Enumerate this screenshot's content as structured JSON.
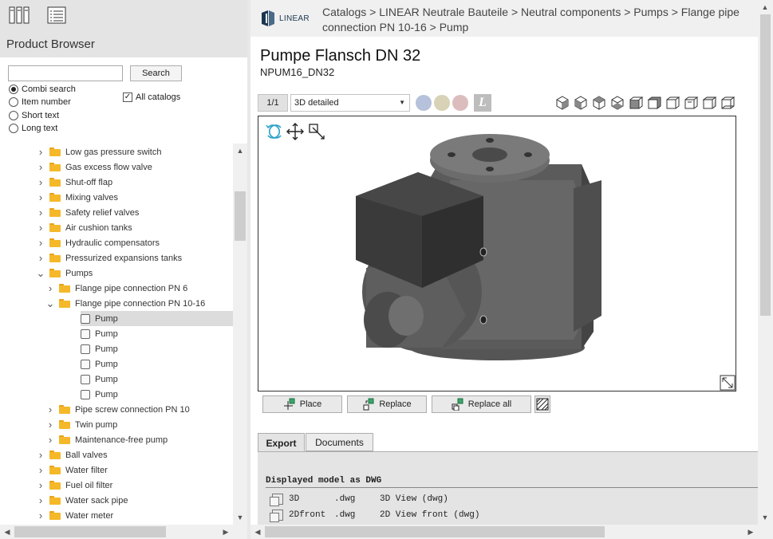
{
  "left_panel": {
    "title": "Product Browser",
    "search": {
      "value": "",
      "placeholder": "",
      "button_label": "Search"
    },
    "search_modes": [
      "Combi search",
      "Item number",
      "Short text",
      "Long text"
    ],
    "selected_mode": "Combi search",
    "all_catalogs_label": "All catalogs",
    "all_catalogs_checked": true,
    "tree": [
      {
        "label": "Low gas pressure switch",
        "type": "folder",
        "level": 0,
        "state": "collapsed"
      },
      {
        "label": "Gas excess flow valve",
        "type": "folder",
        "level": 0,
        "state": "collapsed"
      },
      {
        "label": "Shut-off flap",
        "type": "folder",
        "level": 0,
        "state": "collapsed"
      },
      {
        "label": "Mixing valves",
        "type": "folder",
        "level": 0,
        "state": "collapsed"
      },
      {
        "label": "Safety relief valves",
        "type": "folder",
        "level": 0,
        "state": "collapsed"
      },
      {
        "label": "Air cushion tanks",
        "type": "folder",
        "level": 0,
        "state": "collapsed"
      },
      {
        "label": "Hydraulic compensators",
        "type": "folder",
        "level": 0,
        "state": "collapsed"
      },
      {
        "label": "Pressurized expansions tanks",
        "type": "folder",
        "level": 0,
        "state": "collapsed"
      },
      {
        "label": "Pumps",
        "type": "folder",
        "level": 0,
        "state": "expanded"
      },
      {
        "label": "Flange pipe connection PN 6",
        "type": "folder",
        "level": 1,
        "state": "collapsed"
      },
      {
        "label": "Flange pipe connection PN 10-16",
        "type": "folder",
        "level": 1,
        "state": "expanded"
      },
      {
        "label": "Pump",
        "type": "part",
        "level": 2,
        "selected": true
      },
      {
        "label": "Pump",
        "type": "part",
        "level": 2
      },
      {
        "label": "Pump",
        "type": "part",
        "level": 2
      },
      {
        "label": "Pump",
        "type": "part",
        "level": 2
      },
      {
        "label": "Pump",
        "type": "part",
        "level": 2
      },
      {
        "label": "Pump",
        "type": "part",
        "level": 2
      },
      {
        "label": "Pipe screw connection PN 10",
        "type": "folder",
        "level": 1,
        "state": "collapsed"
      },
      {
        "label": "Twin pump",
        "type": "folder",
        "level": 1,
        "state": "collapsed"
      },
      {
        "label": "Maintenance-free pump",
        "type": "folder",
        "level": 1,
        "state": "collapsed"
      },
      {
        "label": "Ball valves",
        "type": "folder",
        "level": 0,
        "state": "collapsed"
      },
      {
        "label": "Water filter",
        "type": "folder",
        "level": 0,
        "state": "collapsed"
      },
      {
        "label": "Fuel oil filter",
        "type": "folder",
        "level": 0,
        "state": "collapsed"
      },
      {
        "label": "Water sack pipe",
        "type": "folder",
        "level": 0,
        "state": "collapsed"
      },
      {
        "label": "Water meter",
        "type": "folder",
        "level": 0,
        "state": "collapsed"
      }
    ]
  },
  "header": {
    "logo_text": "LINEAR",
    "breadcrumb": "Catalogs > LINEAR Neutrale Bauteile > Neutral components > Pumps  > Flange pipe connection PN 10-16 > Pump"
  },
  "product": {
    "title": "Pumpe Flansch DN  32",
    "id": "NPUM16_DN32"
  },
  "toolbar": {
    "page_indicator": "1/1",
    "view_mode": "3D detailed",
    "l_button": "L"
  },
  "actions": {
    "place": "Place",
    "replace": "Replace",
    "replace_all": "Replace all"
  },
  "tabs": {
    "export": "Export",
    "documents": "Documents"
  },
  "export": {
    "heading": "Displayed model as DWG",
    "rows": [
      {
        "name": "3D",
        "ext": ".dwg",
        "desc": "3D View (dwg)"
      },
      {
        "name": "2Dfront",
        "ext": ".dwg",
        "desc": "2D View front (dwg)"
      }
    ]
  },
  "colors": {
    "folder": "#f5b829",
    "accent_logo": "#1a3550",
    "rotate_icon": "#2aa0c8",
    "button_green": "#3aa56a"
  }
}
